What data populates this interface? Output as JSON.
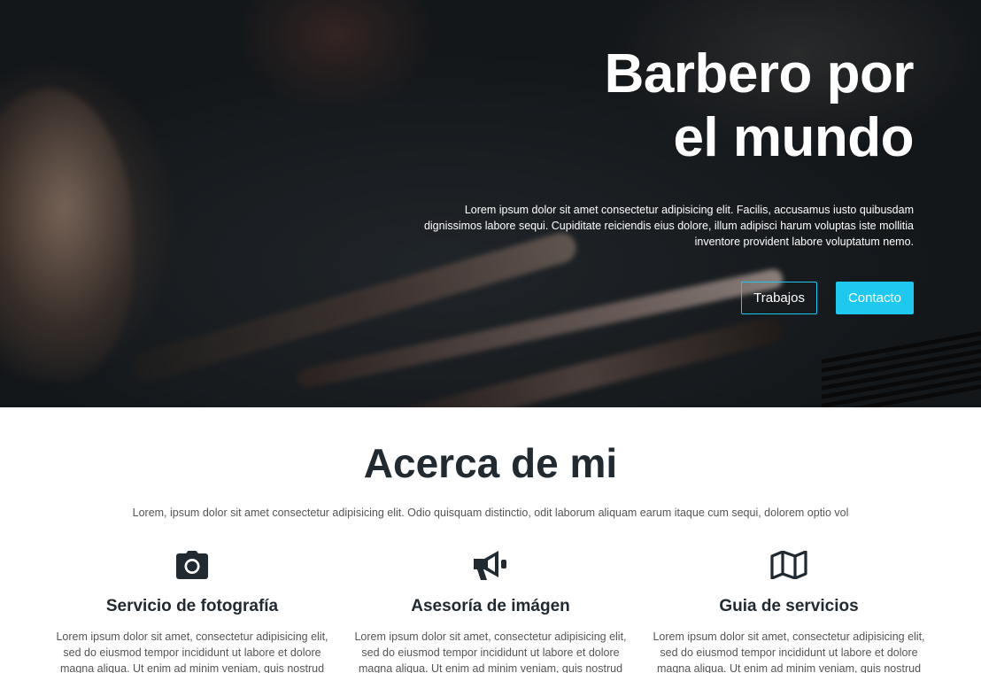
{
  "hero": {
    "title": "Barbero por\nel mundo",
    "text": "Lorem ipsum dolor sit amet consectetur adipisicing elit. Facilis, accusamus iusto quibusdam dignissimos labore sequi. Cupiditate reiciendis eius dolore, illum adipisci harum voluptas iste mollitia inventore provident labore voluptatum nemo.",
    "buttons": [
      {
        "label": "Trabajos"
      },
      {
        "label": "Contacto"
      }
    ]
  },
  "about": {
    "title": "Acerca de mi",
    "lead": "Lorem, ipsum dolor sit amet consectetur adipisicing elit. Odio quisquam distinctio, odit laborum aliquam earum itaque cum sequi, dolorem optio vol",
    "services": [
      {
        "icon": "camera-icon",
        "title": "Servicio de fotografía",
        "text": "Lorem ipsum dolor sit amet, consectetur adipisicing elit, sed do eiusmod tempor incididunt ut labore et dolore magna aliqua. Ut enim ad minim veniam, quis nostrud"
      },
      {
        "icon": "megaphone-icon",
        "title": "Asesoría de imágen",
        "text": "Lorem ipsum dolor sit amet, consectetur adipisicing elit, sed do eiusmod tempor incididunt ut labore et dolore magna aliqua. Ut enim ad minim veniam, quis nostrud"
      },
      {
        "icon": "map-icon",
        "title": "Guia de servicios",
        "text": "Lorem ipsum dolor sit amet, consectetur adipisicing elit, sed do eiusmod tempor incididunt ut labore et dolore magna aliqua. Ut enim ad minim veniam, quis nostrud"
      }
    ]
  },
  "colors": {
    "accent": "#1ec8ee",
    "heading": "#222a31",
    "hero_text": "#ffffff"
  }
}
